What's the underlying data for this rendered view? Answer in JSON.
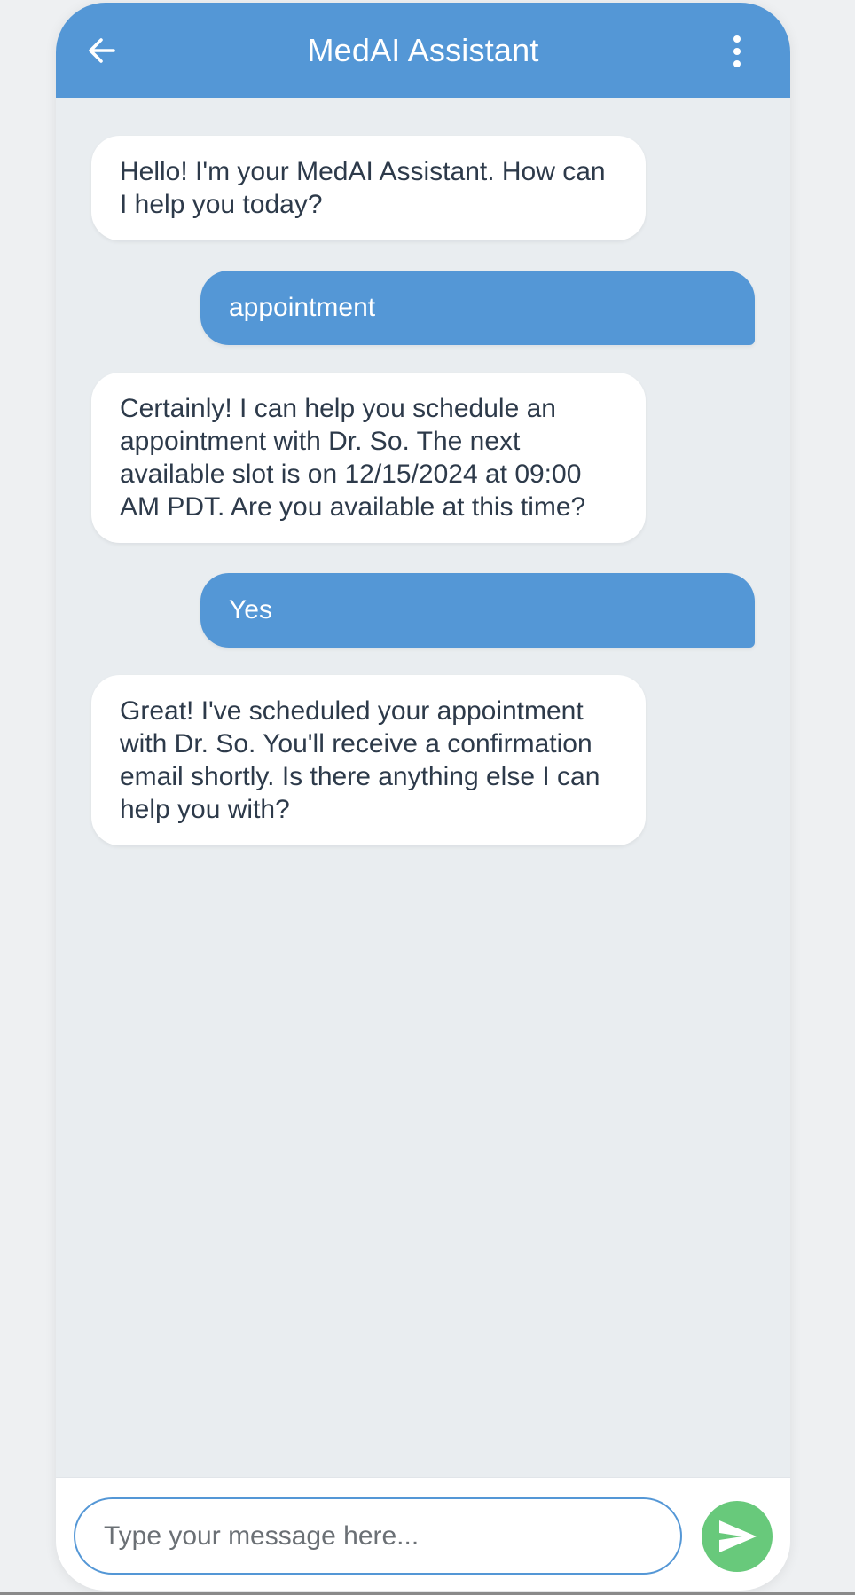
{
  "colors": {
    "accent": "#5497d6",
    "send_button": "#68c97b",
    "background": "#e9edf0"
  },
  "header": {
    "title": "MedAI Assistant",
    "back_icon": "arrow-left-icon",
    "menu_icon": "more-vertical-icon"
  },
  "messages": [
    {
      "sender": "bot",
      "text": "Hello! I'm your MedAI Assistant. How can I help you today?"
    },
    {
      "sender": "user",
      "text": "appointment"
    },
    {
      "sender": "bot",
      "text": "Certainly! I can help you schedule an appointment with Dr. So. The next available slot is on 12/15/2024 at 09:00 AM PDT. Are you available at this time?"
    },
    {
      "sender": "user",
      "text": "Yes"
    },
    {
      "sender": "bot",
      "text": "Great! I've scheduled your appointment with Dr. So. You'll receive a confirmation email shortly. Is there anything else I can help you with?"
    }
  ],
  "input": {
    "value": "",
    "placeholder": "Type your message here..."
  },
  "send_icon": "send-icon"
}
